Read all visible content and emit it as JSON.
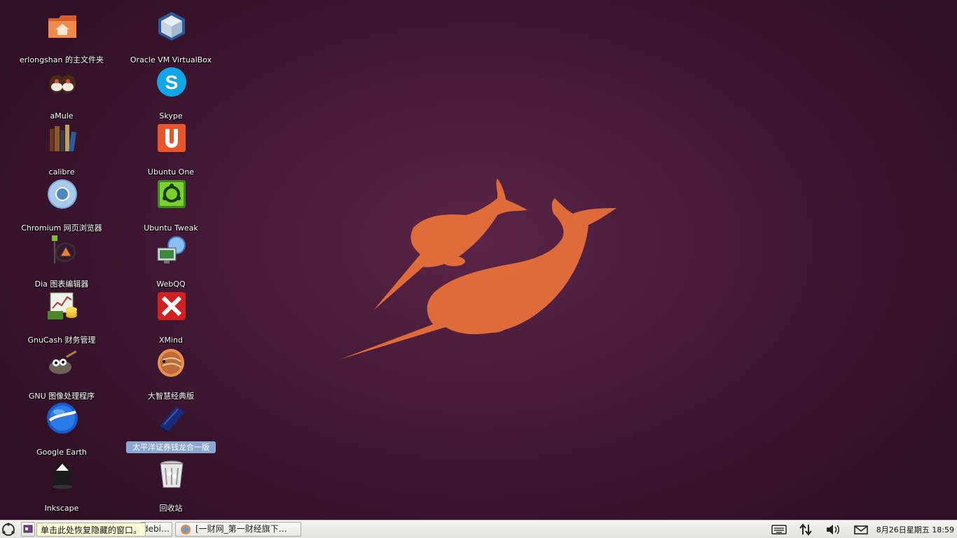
{
  "desktop": {
    "icons_col1": [
      {
        "label": "erlongshan 的主文件夹",
        "icon": "home-folder-icon"
      },
      {
        "label": "aMule",
        "icon": "amule-icon"
      },
      {
        "label": "calibre",
        "icon": "calibre-books-icon"
      },
      {
        "label": "Chromium 网页浏览器",
        "icon": "chromium-icon"
      },
      {
        "label": "Dia 图表编辑器",
        "icon": "dia-icon"
      },
      {
        "label": "GnuCash 财务管理",
        "icon": "gnucash-icon"
      },
      {
        "label": "GNU 图像处理程序",
        "icon": "gimp-icon"
      },
      {
        "label": "Google Earth",
        "icon": "google-earth-icon"
      },
      {
        "label": "Inkscape",
        "icon": "inkscape-icon"
      }
    ],
    "icons_col2": [
      {
        "label": "Oracle VM VirtualBox",
        "icon": "virtualbox-icon"
      },
      {
        "label": "Skype",
        "icon": "skype-icon"
      },
      {
        "label": "Ubuntu One",
        "icon": "ubuntu-one-icon"
      },
      {
        "label": "Ubuntu Tweak",
        "icon": "ubuntu-tweak-icon"
      },
      {
        "label": "WebQQ",
        "icon": "webqq-icon"
      },
      {
        "label": "XMind",
        "icon": "xmind-icon"
      },
      {
        "label": "大智慧经典版",
        "icon": "dazhihui-fish-icon"
      },
      {
        "label": "太平洋证券钱龙合一版",
        "icon": "book-icon",
        "selected": true
      },
      {
        "label": "回收站",
        "icon": "trash-icon"
      }
    ]
  },
  "taskbar": {
    "tooltip": "单击此处恢复隐藏的窗口。",
    "task1_label": "debi…",
    "task2_label": "[一财网_第一财经旗下…",
    "clock": "8月26日星期五  18:59"
  },
  "colors": {
    "wallpaper": "#4a1c3a",
    "narwhal": "#e8703a",
    "selection": "#8aa8d0"
  }
}
